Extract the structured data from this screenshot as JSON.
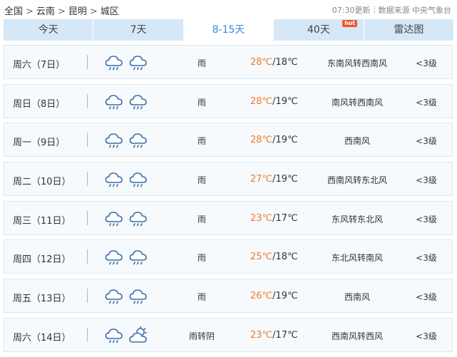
{
  "breadcrumb": {
    "items": [
      "全国",
      "云南",
      "昆明",
      "城区"
    ]
  },
  "meta": {
    "update_time": "07:30更新",
    "source": "数据来源 中央气象台"
  },
  "tabs": [
    {
      "label": "今天",
      "active": false
    },
    {
      "label": "7天",
      "active": false
    },
    {
      "label": "8-15天",
      "active": true
    },
    {
      "label": "40天",
      "active": false,
      "badge": "hot"
    },
    {
      "label": "雷达图",
      "active": false
    }
  ],
  "colors": {
    "accent": "#3a8ad8",
    "tab_bg": "#d6e8f7",
    "high_temp": "#f07a2a",
    "hot_badge": "#f0552b",
    "icon_stroke": "#3a6fa8"
  },
  "forecast": [
    {
      "day": "周六（7日）",
      "icons": [
        "rain-cloud-icon",
        "rain-cloud-icon"
      ],
      "weather": "雨",
      "high": "28℃",
      "low": "/18℃",
      "wind": "东南风转西南风",
      "level": "<3级"
    },
    {
      "day": "周日（8日）",
      "icons": [
        "rain-cloud-icon",
        "rain-cloud-icon"
      ],
      "weather": "雨",
      "high": "28℃",
      "low": "/19℃",
      "wind": "南风转西南风",
      "level": "<3级"
    },
    {
      "day": "周一（9日）",
      "icons": [
        "rain-cloud-icon",
        "rain-cloud-icon"
      ],
      "weather": "雨",
      "high": "28℃",
      "low": "/19℃",
      "wind": "西南风",
      "level": "<3级"
    },
    {
      "day": "周二（10日）",
      "icons": [
        "rain-cloud-icon",
        "rain-cloud-icon"
      ],
      "weather": "雨",
      "high": "27℃",
      "low": "/19℃",
      "wind": "西南风转东北风",
      "level": "<3级"
    },
    {
      "day": "周三（11日）",
      "icons": [
        "rain-cloud-icon",
        "rain-cloud-icon"
      ],
      "weather": "雨",
      "high": "23℃",
      "low": "/17℃",
      "wind": "东风转东北风",
      "level": "<3级"
    },
    {
      "day": "周四（12日）",
      "icons": [
        "rain-cloud-icon",
        "rain-cloud-icon"
      ],
      "weather": "雨",
      "high": "25℃",
      "low": "/18℃",
      "wind": "东北风转南风",
      "level": "<3级"
    },
    {
      "day": "周五（13日）",
      "icons": [
        "rain-cloud-icon",
        "rain-cloud-icon"
      ],
      "weather": "雨",
      "high": "26℃",
      "low": "/19℃",
      "wind": "西南风",
      "level": "<3级"
    },
    {
      "day": "周六（14日）",
      "icons": [
        "rain-cloud-icon",
        "partly-cloudy-icon"
      ],
      "weather": "雨转阴",
      "high": "23℃",
      "low": "/17℃",
      "wind": "西南风转西风",
      "level": "<3级"
    }
  ]
}
